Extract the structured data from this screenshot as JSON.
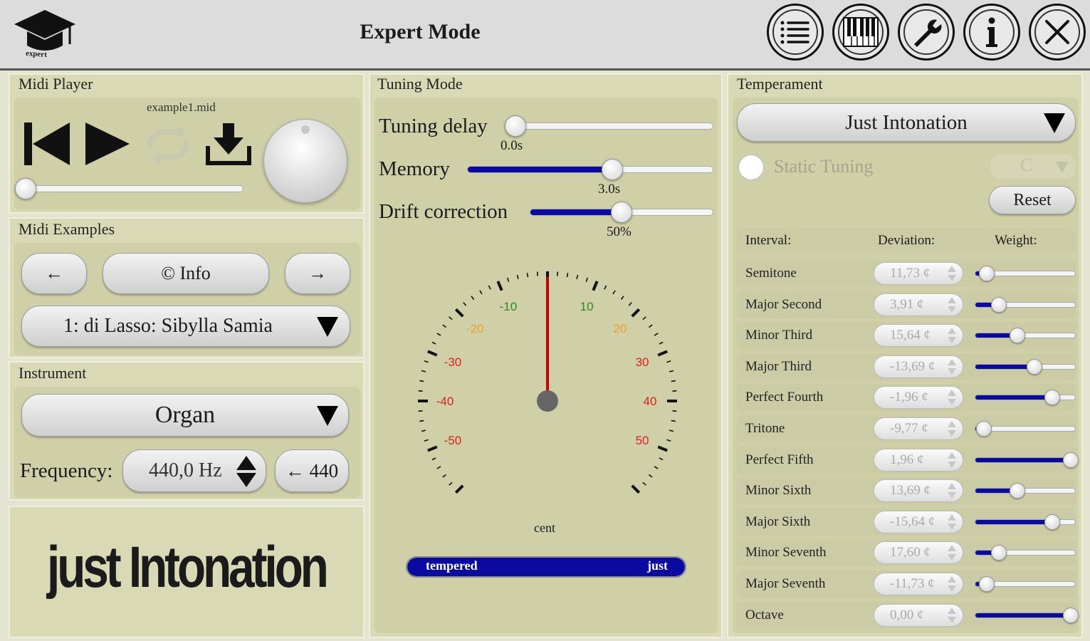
{
  "header": {
    "title": "Expert Mode",
    "logo_text": "expert",
    "buttons": [
      "list-icon",
      "piano-icon",
      "wrench-icon",
      "info-icon",
      "close-icon"
    ]
  },
  "midi_player": {
    "title": "Midi Player",
    "filename": "example1.mid",
    "progress": 0
  },
  "midi_examples": {
    "title": "Midi Examples",
    "prev_label": "←",
    "info_label": "© Info",
    "next_label": "→",
    "selected": "1: di Lasso: Sibylla Samia"
  },
  "instrument": {
    "title": "Instrument",
    "selected": "Organ",
    "frequency_label": "Frequency:",
    "frequency_value": "440,0 Hz",
    "reset_label": "← 440"
  },
  "logo": {
    "text": "just Intonation"
  },
  "tuning_mode": {
    "title": "Tuning Mode",
    "sliders": [
      {
        "label": "Tuning delay",
        "value_text": "0.0s",
        "fraction": 0.0
      },
      {
        "label": "Memory",
        "value_text": "3.0s",
        "fraction": 0.59
      },
      {
        "label": "Drift correction",
        "value_text": "50%",
        "fraction": 0.5
      }
    ],
    "gauge": {
      "unit_label": "cent",
      "tick_labels": [
        "-10",
        "10",
        "-20",
        "20",
        "-30",
        "30",
        "-40",
        "40",
        "-50",
        "50"
      ],
      "needle_cents": 0
    },
    "bar": {
      "left_label": "tempered",
      "right_label": "just",
      "fraction": 1.0
    }
  },
  "temperament": {
    "title": "Temperament",
    "selected": "Just Intonation",
    "static_tuning_label": "Static Tuning",
    "static_key": "C",
    "reset_label": "Reset",
    "columns": [
      "Interval:",
      "Deviation:",
      "Weight:"
    ],
    "rows": [
      {
        "interval": "Semitone",
        "deviation": "11,73 ¢",
        "weight": 0.12
      },
      {
        "interval": "Major Second",
        "deviation": "3,91 ¢",
        "weight": 0.24
      },
      {
        "interval": "Minor Third",
        "deviation": "15,64 ¢",
        "weight": 0.42
      },
      {
        "interval": "Major Third",
        "deviation": "-13,69 ¢",
        "weight": 0.59
      },
      {
        "interval": "Perfect Fourth",
        "deviation": "-1,96 ¢",
        "weight": 0.77
      },
      {
        "interval": "Tritone",
        "deviation": "-9,77 ¢",
        "weight": 0.09
      },
      {
        "interval": "Perfect Fifth",
        "deviation": "1,96 ¢",
        "weight": 0.95
      },
      {
        "interval": "Minor Sixth",
        "deviation": "13,69 ¢",
        "weight": 0.42
      },
      {
        "interval": "Major Sixth",
        "deviation": "-15,64 ¢",
        "weight": 0.77
      },
      {
        "interval": "Minor Seventh",
        "deviation": "17,60 ¢",
        "weight": 0.24
      },
      {
        "interval": "Major Seventh",
        "deviation": "-11,73 ¢",
        "weight": 0.12
      },
      {
        "interval": "Octave",
        "deviation": "0,00 ¢",
        "weight": 0.95
      }
    ]
  }
}
